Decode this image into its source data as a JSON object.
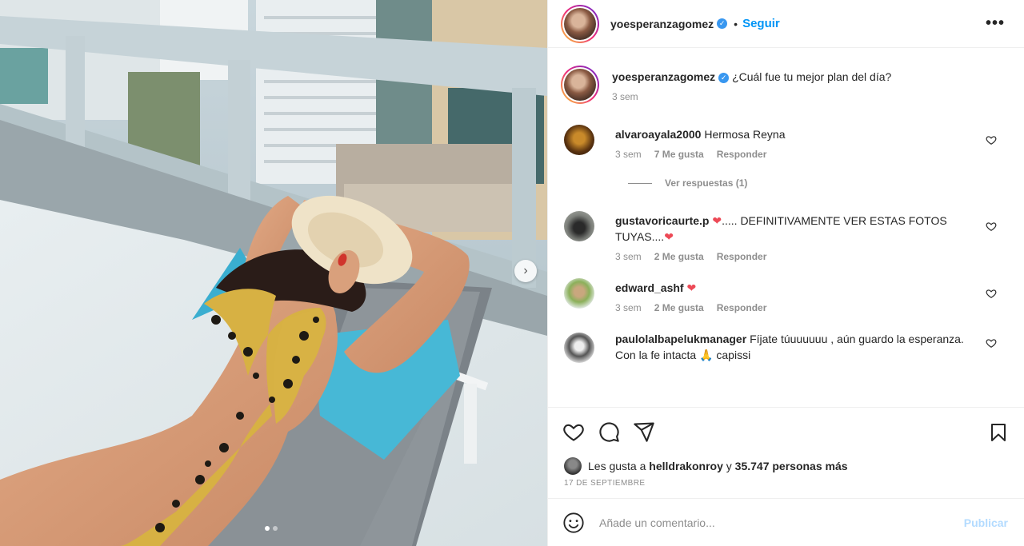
{
  "post": {
    "username": "yoesperanzagomez",
    "follow_label": "Seguir",
    "separator": "•",
    "more_label": "•••"
  },
  "caption": {
    "username": "yoesperanzagomez",
    "text": "¿Cuál fue tu mejor plan del día?",
    "time": "3 sem"
  },
  "comments": [
    {
      "username": "alvaroayala2000",
      "text": "Hermosa Reyna",
      "time": "3 sem",
      "likes": "7 Me gusta",
      "reply": "Responder",
      "view_replies": "Ver respuestas (1)"
    },
    {
      "username": "gustavoricaurte.p",
      "text_a": "..... DEFINITIVAMENTE VER ESTAS FOTOS TUYAS....",
      "time": "3 sem",
      "likes": "2 Me gusta",
      "reply": "Responder"
    },
    {
      "username": "edward_ashf",
      "time": "3 sem",
      "likes": "2 Me gusta",
      "reply": "Responder"
    },
    {
      "username": "paulolalbapelukmanager",
      "text": "Fíjate túuuuuuu , aún guardo la esperanza. Con la fe intacta 🙏 capissi"
    }
  ],
  "likes": {
    "prefix": "Les gusta a",
    "user": "helldrakonroy",
    "conj": "y",
    "count": "35.747 personas más"
  },
  "date": "17 DE SEPTIEMBRE",
  "add_comment": {
    "placeholder": "Añade un comentario...",
    "publish": "Publicar"
  },
  "carousel": {
    "current": 1,
    "total": 2
  },
  "colors": {
    "accent": "#0095f6",
    "heart": "#ed4956",
    "publish_disabled": "#b3dbff"
  }
}
